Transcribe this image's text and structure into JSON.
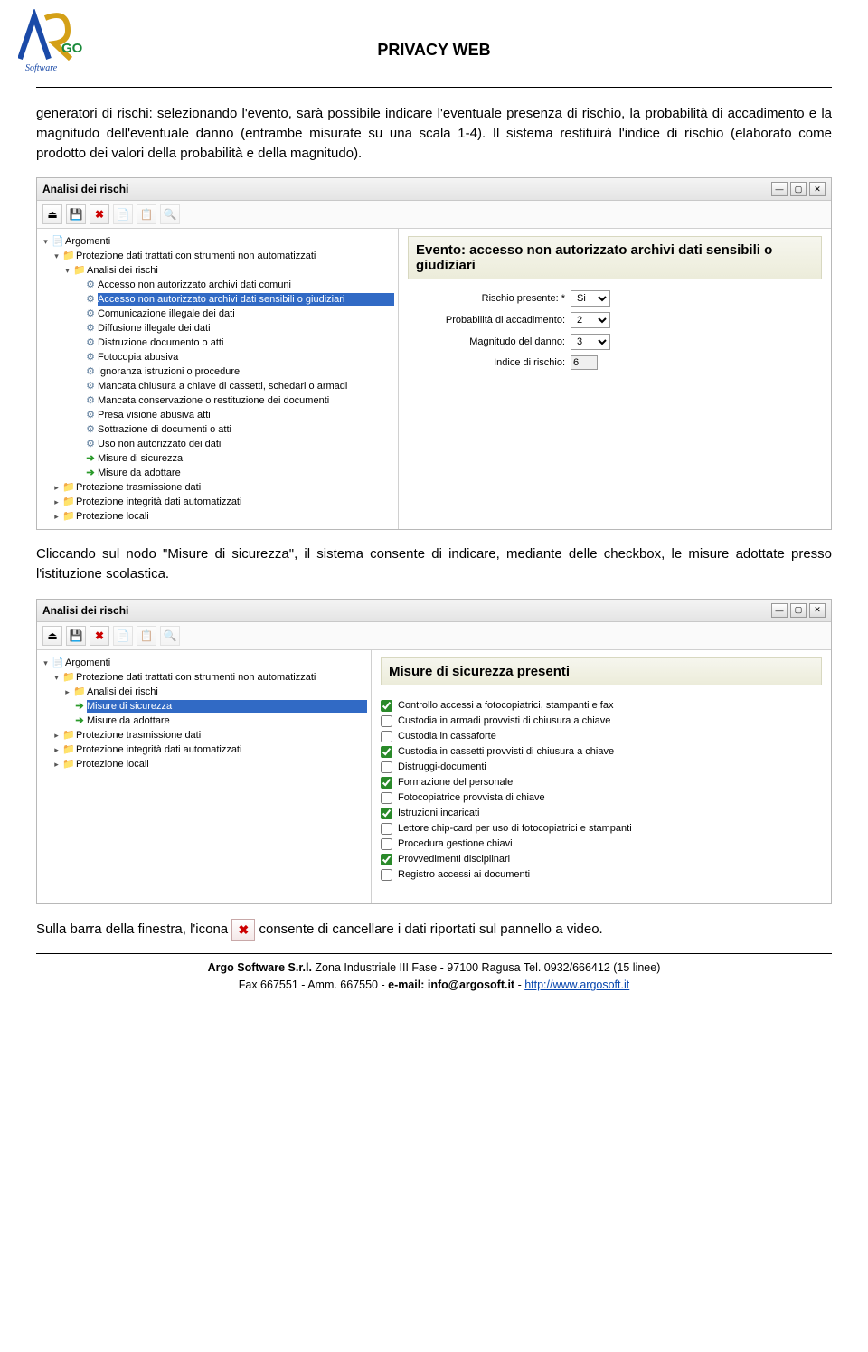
{
  "header": {
    "title": "PRIVACY WEB",
    "logo_text1": "AR",
    "logo_text2": "GO",
    "logo_sub": "Software"
  },
  "para1": "generatori di rischi: selezionando l'evento, sarà possibile indicare l'eventuale presenza di rischio, la probabilità di accadimento e la magnitudo dell'eventuale danno (entrambe misurate su una scala 1-4). Il sistema restituirà l'indice di rischio (elaborato come prodotto dei valori della probabilità  e della magnitudo).",
  "win1": {
    "title": "Analisi dei rischi",
    "event_heading": "Evento: accesso non autorizzato archivi dati sensibili o giudiziari",
    "form": {
      "rischio_label": "Rischio presente: *",
      "rischio_val": "Si",
      "prob_label": "Probabilità di accadimento:",
      "prob_val": "2",
      "mag_label": "Magnitudo del danno:",
      "mag_val": "3",
      "idx_label": "Indice di rischio:",
      "idx_val": "6"
    },
    "tree": {
      "root": "Argomenti",
      "n1": "Protezione dati trattati con strumenti non automatizzati",
      "n2": "Analisi dei rischi",
      "items": [
        "Accesso non autorizzato archivi dati comuni",
        "Accesso non autorizzato archivi dati sensibili o giudiziari",
        "Comunicazione illegale dei dati",
        "Diffusione illegale dei dati",
        "Distruzione documento o atti",
        "Fotocopia abusiva",
        "Ignoranza istruzioni o procedure",
        "Mancata chiusura a chiave di cassetti, schedari o armadi",
        "Mancata conservazione o restituzione dei documenti",
        "Presa visione abusiva atti",
        "Sottrazione di documenti o atti",
        "Uso non autorizzato dei dati"
      ],
      "mis1": "Misure di sicurezza",
      "mis2": "Misure da adottare",
      "p1": "Protezione trasmissione dati",
      "p2": "Protezione integrità  dati automatizzati",
      "p3": "Protezione locali"
    }
  },
  "para2": "Cliccando sul nodo \"Misure di sicurezza\", il sistema consente di indicare, mediante delle checkbox, le misure adottate presso l'istituzione scolastica.",
  "win2": {
    "title": "Analisi dei rischi",
    "heading": "Misure di sicurezza presenti",
    "tree": {
      "root": "Argomenti",
      "n1": "Protezione dati trattati con strumenti non automatizzati",
      "a1": "Analisi dei rischi",
      "sel": "Misure di sicurezza",
      "a2": "Misure da adottare",
      "p1": "Protezione trasmissione dati",
      "p2": "Protezione integrità  dati automatizzati",
      "p3": "Protezione locali"
    },
    "checks": [
      {
        "c": true,
        "t": "Controllo accessi a fotocopiatrici, stampanti e fax"
      },
      {
        "c": false,
        "t": "Custodia in armadi provvisti di chiusura a chiave"
      },
      {
        "c": false,
        "t": "Custodia in cassaforte"
      },
      {
        "c": true,
        "t": "Custodia in cassetti provvisti di chiusura a chiave"
      },
      {
        "c": false,
        "t": "Distruggi-documenti"
      },
      {
        "c": true,
        "t": "Formazione del personale"
      },
      {
        "c": false,
        "t": "Fotocopiatrice provvista di chiave"
      },
      {
        "c": true,
        "t": "Istruzioni incaricati"
      },
      {
        "c": false,
        "t": "Lettore chip-card per uso di fotocopiatrici e stampanti"
      },
      {
        "c": false,
        "t": "Procedura gestione chiavi"
      },
      {
        "c": true,
        "t": "Provvedimenti disciplinari"
      },
      {
        "c": false,
        "t": "Registro accessi ai documenti"
      }
    ]
  },
  "para3a": "Sulla barra della finestra, l'icona ",
  "para3b": " consente di cancellare  i dati riportati sul pannello a video.",
  "footer": {
    "l1a": "Argo Software S.r.l.",
    "l1b": " Zona Industriale III Fase - 97100 Ragusa Tel. 0932/666412 (15 linee)",
    "l2a": "Fax 667551 - Amm. 667550 - ",
    "l2b": "e-mail: info@argosoft.it",
    "l2c": " - ",
    "link": "http://www.argosoft.it"
  },
  "icon_x": "✖"
}
